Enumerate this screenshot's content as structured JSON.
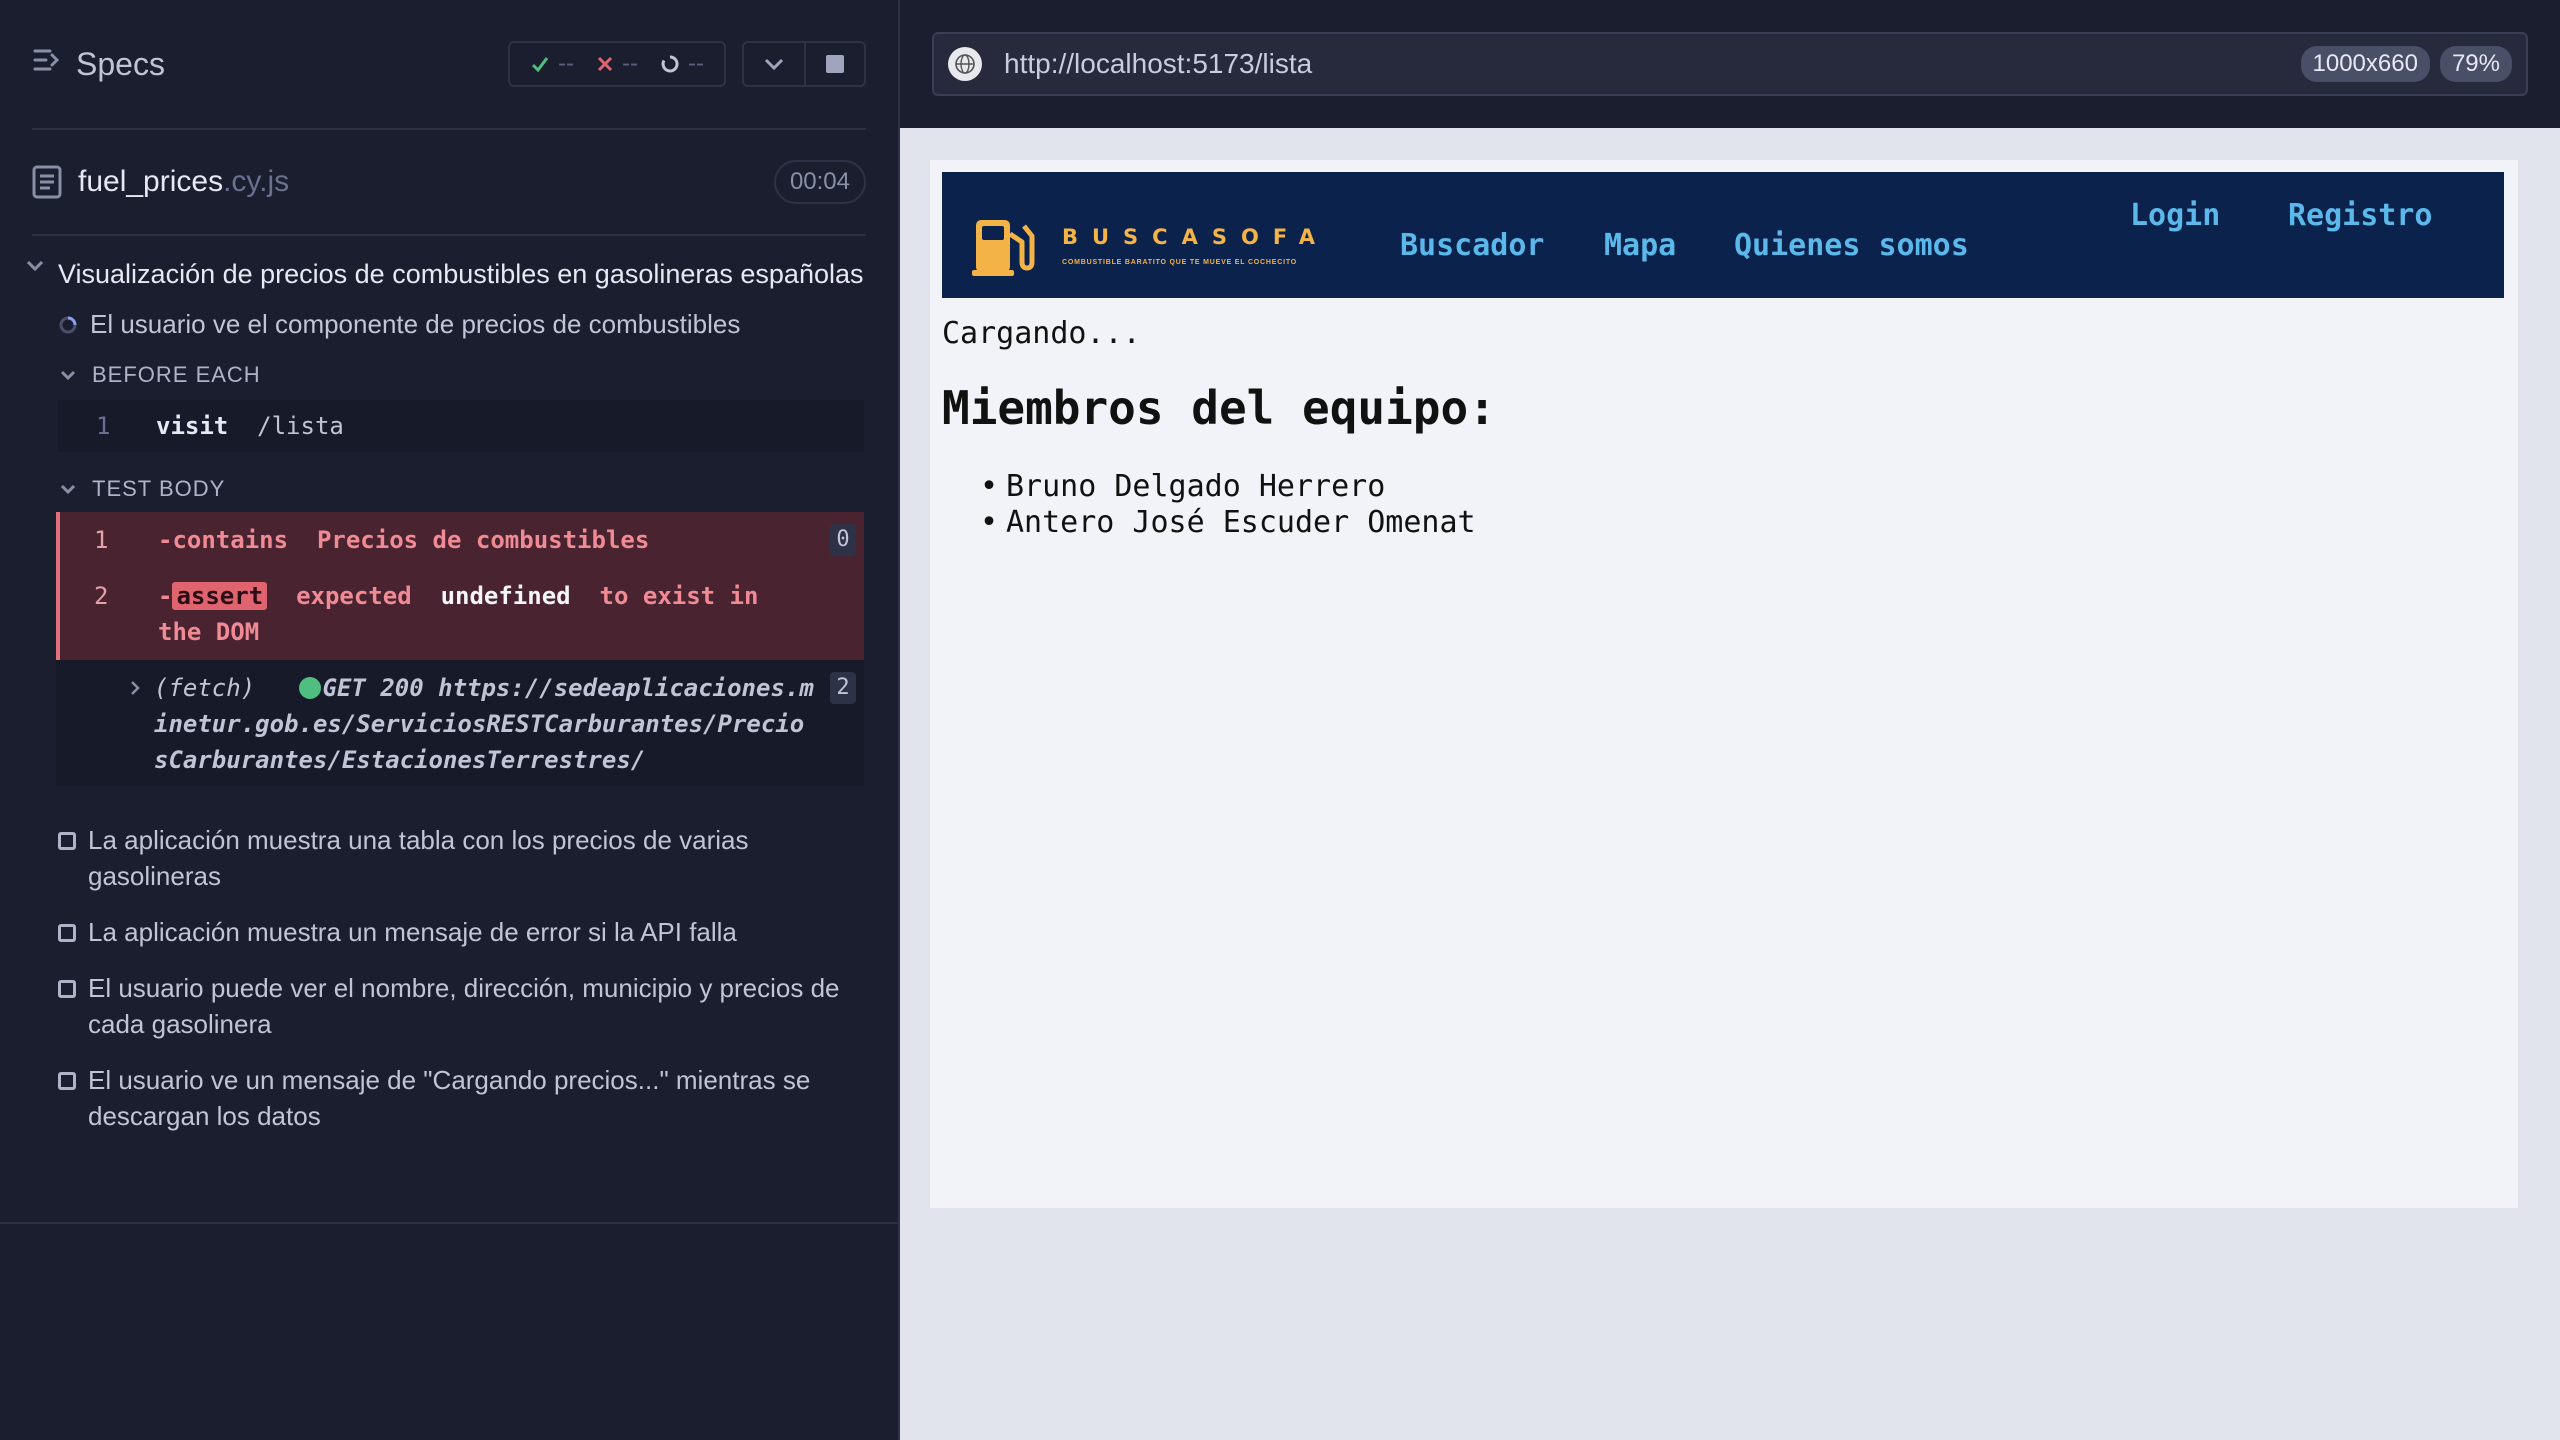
{
  "reporter": {
    "specs_label": "Specs",
    "stats": {
      "passed": "--",
      "failed": "--",
      "pending": "--"
    },
    "file": {
      "name": "fuel_prices",
      "ext": ".cy.js",
      "duration": "00:04"
    },
    "suite_title": "Visualización de precios de combustibles en gasolineras españolas",
    "running_test": "El usuario ve el componente de precios de combustibles",
    "before_each_label": "BEFORE EACH",
    "before_each_cmds": [
      {
        "num": "1",
        "name": "visit",
        "arg": "/lista"
      }
    ],
    "test_body_label": "TEST BODY",
    "body_cmds": {
      "c1": {
        "num": "1",
        "name": "-contains",
        "arg": "Precios de combustibles",
        "badge": "0"
      },
      "c2": {
        "num": "2",
        "dash": "-",
        "pill": "assert",
        "expected": "expected",
        "undef": "undefined",
        "tail": "to exist in the DOM"
      },
      "fetch": {
        "label": "(fetch)",
        "method": "GET 200",
        "url": "https://sedeaplicaciones.minetur.gob.es/ServiciosRESTCarburantes/PreciosCarburantes/EstacionesTerrestres/",
        "badge": "2"
      }
    },
    "pending_tests": [
      "La aplicación muestra una tabla con los precios de varias gasolineras",
      "La aplicación muestra un mensaje de error si la API falla",
      "El usuario puede ver el nombre, dirección, municipio y precios de cada gasolinera",
      "El usuario ve un mensaje de \"Cargando precios...\" mientras se descargan los datos"
    ]
  },
  "aut": {
    "url": "http://localhost:5173/lista",
    "viewport": "1000x660",
    "zoom": "79%"
  },
  "app": {
    "logo_title": "BUSCASOFA",
    "logo_sub": "COMBUSTIBLE BARATITO QUE TE MUEVE EL COCHECITO",
    "nav": {
      "buscador": "Buscador",
      "mapa": "Mapa",
      "quienes": "Quienes somos",
      "login": "Login",
      "registro": "Registro"
    },
    "loading": "Cargando...",
    "team_heading": "Miembros del equipo:",
    "members": [
      "Bruno Delgado Herrero",
      "Antero José Escuder Omenat"
    ]
  },
  "colors": {
    "navbar": "#0a224c",
    "accent_gold": "#f4b347",
    "link_blue": "#5bb8ea",
    "fail_red": "#e06470",
    "success_green": "#4fbf7f"
  }
}
